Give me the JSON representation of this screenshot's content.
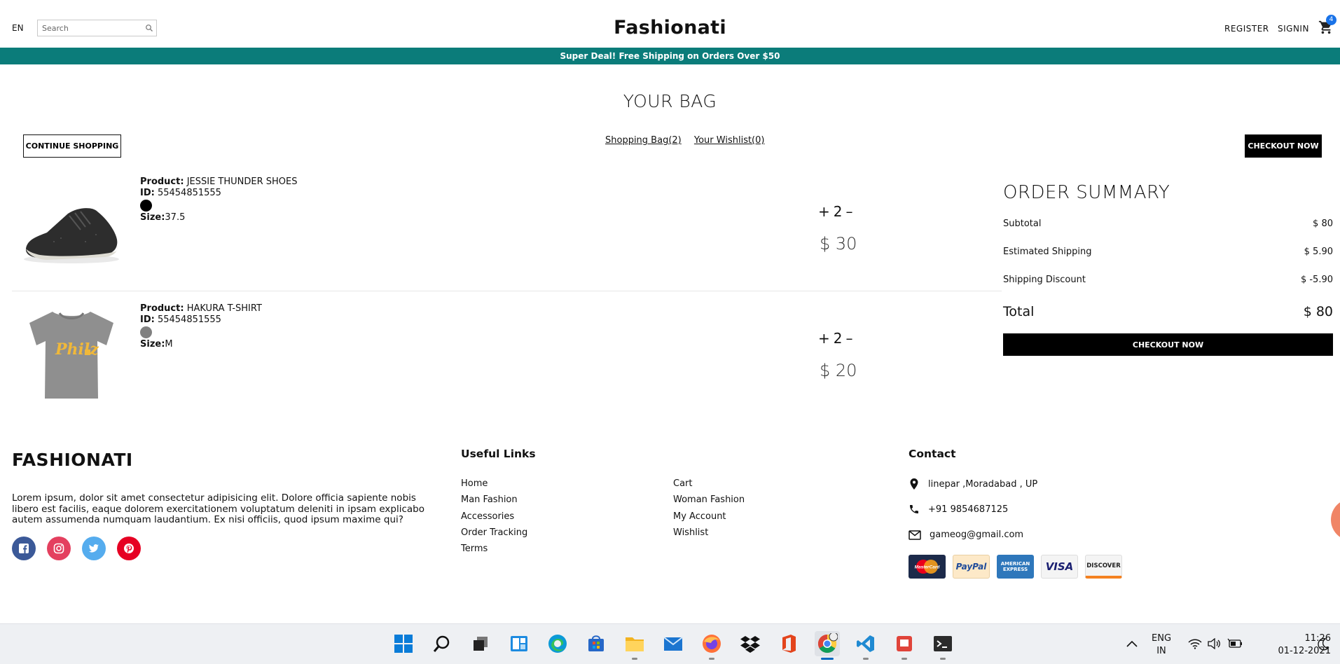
{
  "navbar": {
    "language": "EN",
    "search_placeholder": "Search",
    "logo": "Fashionati",
    "register": "REGISTER",
    "signin": "SIGNIN",
    "cart_count": "4"
  },
  "announcement": "Super Deal! Free Shipping on Orders Over $50",
  "page_title": "YOUR BAG",
  "actions": {
    "continue": "CONTINUE SHOPPING",
    "tab_bag": "Shopping Bag(2)",
    "tab_wishlist": "Your Wishlist(0)",
    "checkout_top": "CHECKOUT NOW"
  },
  "products": [
    {
      "product_label": "Product:",
      "product_name": "JESSIE THUNDER SHOES",
      "id_label": "ID:",
      "id": "55454851555",
      "color": "#000000",
      "size_label": "Size:",
      "size": "37.5",
      "qty_plus": "+",
      "quantity": "2",
      "qty_minus": "–",
      "price": "$ 30"
    },
    {
      "product_label": "Product:",
      "product_name": "HAKURA T-SHIRT",
      "id_label": "ID:",
      "id": "55454851555",
      "color": "#808080",
      "size_label": "Size:",
      "size": "M",
      "qty_plus": "+",
      "quantity": "2",
      "qty_minus": "–",
      "price": "$ 20",
      "shirt_print": "Philz"
    }
  ],
  "summary": {
    "title": "ORDER SUMMARY",
    "subtotal_label": "Subtotal",
    "subtotal": "$ 80",
    "shipping_label": "Estimated Shipping",
    "shipping": "$ 5.90",
    "discount_label": "Shipping Discount",
    "discount": "$ -5.90",
    "total_label": "Total",
    "total": "$ 80",
    "checkout": "CHECKOUT NOW"
  },
  "footer": {
    "brand": "FASHIONATI",
    "about": "Lorem ipsum, dolor sit amet consectetur adipisicing elit. Dolore officia sapiente nobis libero est facilis, eaque dolorem exercitationem voluptatum deleniti in ipsam explicabo autem assumenda numquam laudantium. Ex nisi officiis, quod ipsum maxime qui?",
    "socials": [
      "facebook-icon",
      "instagram-icon",
      "twitter-icon",
      "pinterest-icon"
    ],
    "links_title": "Useful Links",
    "links_col1": [
      "Home",
      "Man Fashion",
      "Accessories",
      "Order Tracking",
      "Terms"
    ],
    "links_col2": [
      "Cart",
      "Woman Fashion",
      "My Account",
      "Wishlist"
    ],
    "contact_title": "Contact",
    "address": "linepar ,Moradabad , UP",
    "phone": "+91 9854687125",
    "email": "gameog@gmail.com",
    "payments": [
      "MasterCard",
      "PayPal",
      "AMERICAN EXPRESS",
      "VISA",
      "DISCOVER"
    ]
  },
  "taskbar": {
    "lang_top": "ENG",
    "lang_bottom": "IN",
    "time": "11:26",
    "date": "01-12-2021"
  },
  "colors": {
    "accent": "#0b7c7a",
    "cart_badge": "#1a73e8"
  }
}
